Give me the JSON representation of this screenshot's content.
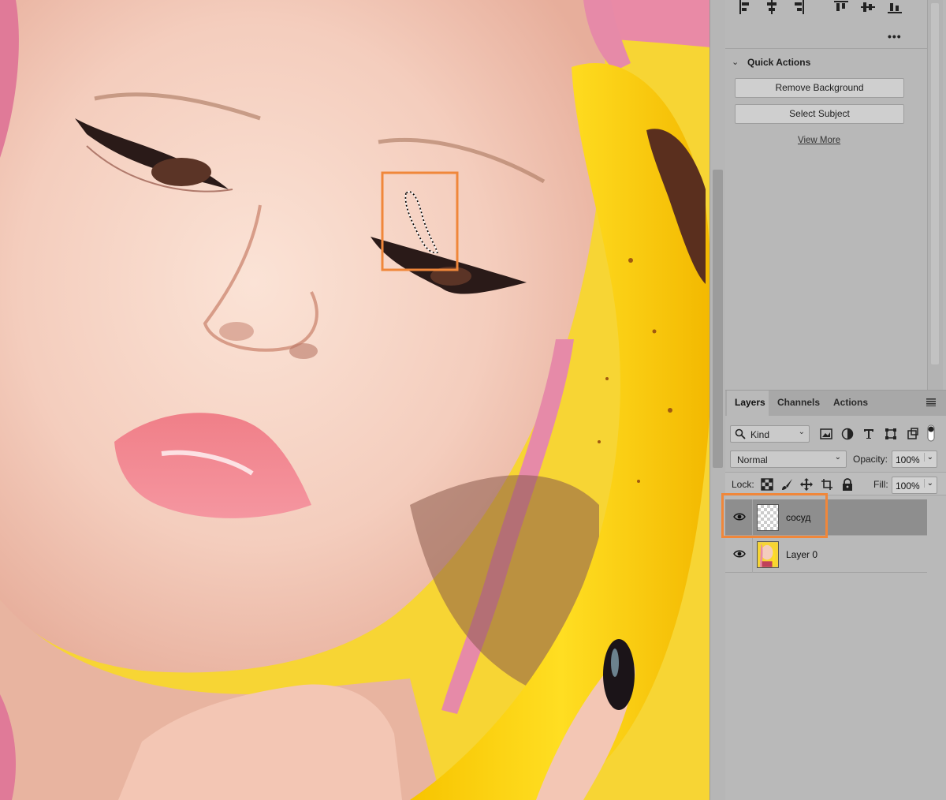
{
  "quick_actions": {
    "title": "Quick Actions",
    "remove_background": "Remove Background",
    "select_subject": "Select Subject",
    "view_more": "View More"
  },
  "align_toolbar": {
    "more": "•••",
    "icons": [
      "align-left-edges-icon",
      "align-horizontal-centers-icon",
      "align-right-edges-icon",
      "align-top-edges-icon",
      "align-vertical-centers-icon",
      "align-bottom-edges-icon"
    ]
  },
  "layers_panel": {
    "tabs": [
      "Layers",
      "Channels",
      "Actions"
    ],
    "active_tab": "Layers",
    "filter_kind": "Kind",
    "blend_mode": "Normal",
    "opacity_label": "Opacity:",
    "opacity_value": "100%",
    "lock_label": "Lock:",
    "fill_label": "Fill:",
    "fill_value": "100%",
    "layers": [
      {
        "name": "сосуд",
        "visible": true,
        "selected": true,
        "thumbnail": "transparent"
      },
      {
        "name": "Layer 0",
        "visible": true,
        "selected": false,
        "thumbnail": "photo"
      }
    ]
  },
  "colors": {
    "annotation_highlight": "#f0873a",
    "panel_bg": "#b8b8b8",
    "selected_layer_bg": "#8e8e8e"
  }
}
